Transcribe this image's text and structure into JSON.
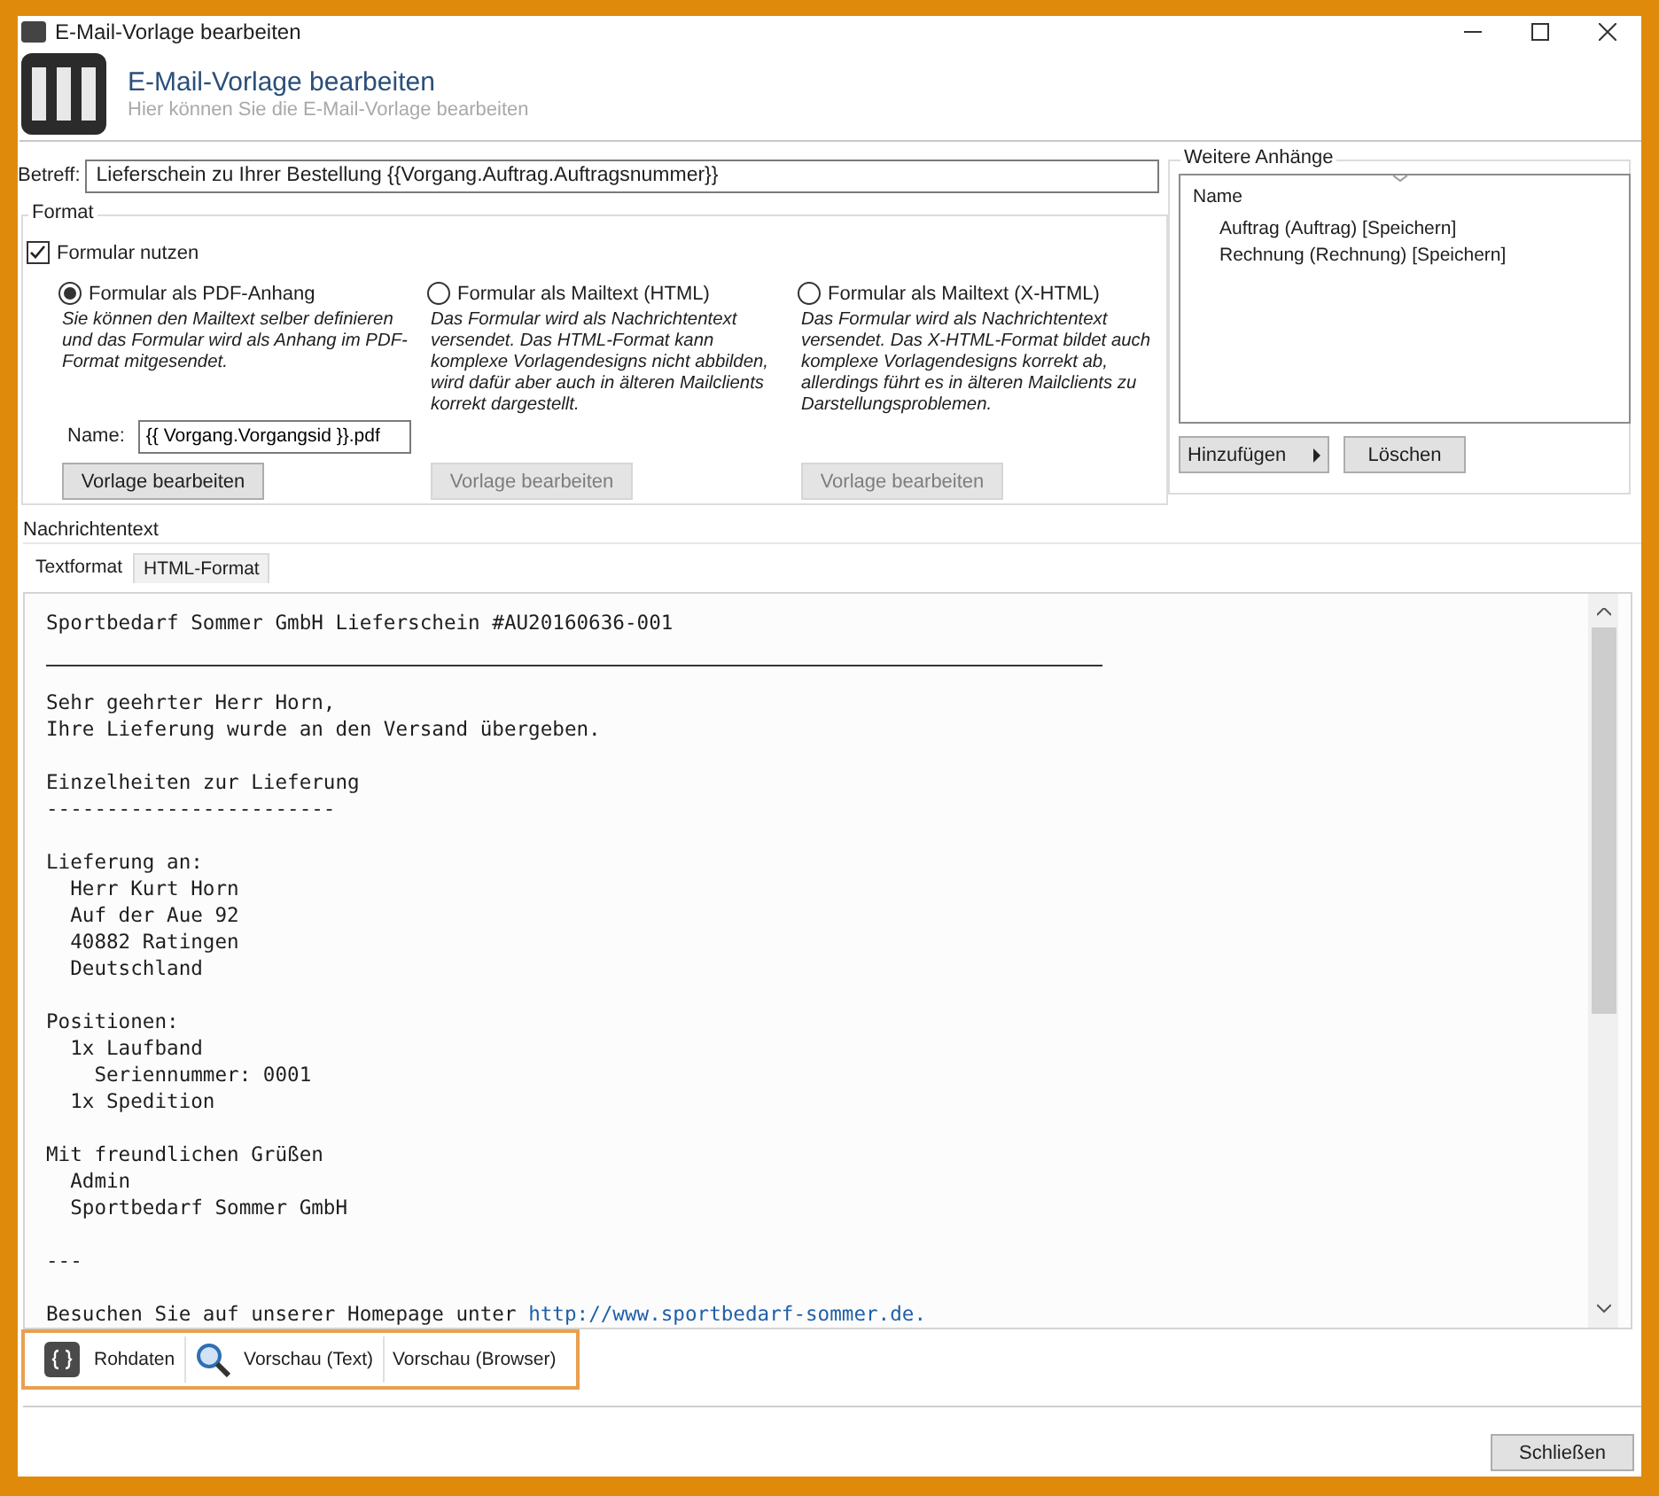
{
  "window": {
    "title": "E-Mail-Vorlage bearbeiten"
  },
  "header": {
    "title": "E-Mail-Vorlage bearbeiten",
    "subtitle": "Hier können Sie die E-Mail-Vorlage bearbeiten"
  },
  "subject": {
    "label": "Betreff:",
    "value": "Lieferschein zu Ihrer Bestellung {{Vorgang.Auftrag.Auftragsnummer}}"
  },
  "format": {
    "title": "Format",
    "use_form": {
      "label": "Formular nutzen",
      "checked": true
    },
    "options": [
      {
        "label": "Formular als PDF-Anhang",
        "selected": true,
        "description": "Sie können den Mailtext selber definieren und das Formular wird als Anhang im PDF-Format mitgesendet.",
        "name_field": {
          "label": "Name:",
          "value": "{{ Vorgang.Vorgangsid }}.pdf"
        },
        "button": {
          "label": "Vorlage bearbeiten",
          "disabled": false
        }
      },
      {
        "label": "Formular als Mailtext (HTML)",
        "selected": false,
        "description": "Das Formular wird als Nachrichtentext versendet. Das HTML-Format kann komplexe Vorlagendesigns nicht abbilden, wird dafür aber auch in älteren Mailclients korrekt dargestellt.",
        "button": {
          "label": "Vorlage bearbeiten",
          "disabled": true
        }
      },
      {
        "label": "Formular als Mailtext (X-HTML)",
        "selected": false,
        "description": "Das Formular wird als Nachrichtentext versendet. Das X-HTML-Format bildet auch komplexe Vorlagendesigns korrekt ab, allerdings führt es in älteren Mailclients zu Darstellungsproblemen.",
        "button": {
          "label": "Vorlage bearbeiten",
          "disabled": true
        }
      }
    ]
  },
  "attachments": {
    "title": "Weitere Anhänge",
    "column": "Name",
    "items": [
      "Auftrag (Auftrag) [Speichern]",
      "Rechnung (Rechnung) [Speichern]"
    ],
    "buttons": [
      {
        "label": "Hinzufügen",
        "kind": "menu"
      },
      {
        "label": "Löschen",
        "kind": "plain"
      }
    ]
  },
  "message": {
    "title": "Nachrichtentext",
    "tabs": [
      {
        "label": "Textformat",
        "selected": true
      },
      {
        "label": "HTML-Format",
        "selected": false
      }
    ],
    "lines": [
      {
        "kind": "text",
        "text": "Sportbedarf Sommer GmbH Lieferschein #AU20160636-001"
      },
      {
        "kind": "rule"
      },
      {
        "kind": "blank"
      },
      {
        "kind": "text",
        "text": "Sehr geehrter Herr Horn,"
      },
      {
        "kind": "text",
        "text": "Ihre Lieferung wurde an den Versand übergeben."
      },
      {
        "kind": "blank"
      },
      {
        "kind": "text",
        "text": "Einzelheiten zur Lieferung"
      },
      {
        "kind": "text",
        "text": "------------------------"
      },
      {
        "kind": "blank"
      },
      {
        "kind": "text",
        "text": "Lieferung an:"
      },
      {
        "kind": "text",
        "text": "  Herr Kurt Horn"
      },
      {
        "kind": "text",
        "text": "  Auf der Aue 92"
      },
      {
        "kind": "text",
        "text": "  40882 Ratingen"
      },
      {
        "kind": "text",
        "text": "  Deutschland"
      },
      {
        "kind": "blank"
      },
      {
        "kind": "text",
        "text": "Positionen:"
      },
      {
        "kind": "text",
        "text": "  1x Laufband"
      },
      {
        "kind": "text",
        "text": "    Seriennummer: 0001"
      },
      {
        "kind": "text",
        "text": "  1x Spedition"
      },
      {
        "kind": "blank"
      },
      {
        "kind": "text",
        "text": "Mit freundlichen Grüßen"
      },
      {
        "kind": "text",
        "text": "  Admin"
      },
      {
        "kind": "text",
        "text": "  Sportbedarf Sommer GmbH"
      },
      {
        "kind": "blank"
      },
      {
        "kind": "text",
        "text": "---"
      },
      {
        "kind": "blank"
      },
      {
        "kind": "link",
        "text": "Besuchen Sie auf unserer Homepage unter ",
        "link": "http://www.sportbedarf-sommer.de."
      }
    ]
  },
  "toolbar": [
    {
      "label": "Rohdaten",
      "kind": "braces"
    },
    {
      "label": "Vorschau (Text)",
      "kind": "magnifier"
    },
    {
      "label": "Vorschau (Browser)",
      "kind": "none"
    }
  ],
  "footer": {
    "close_button": "Schließen"
  }
}
